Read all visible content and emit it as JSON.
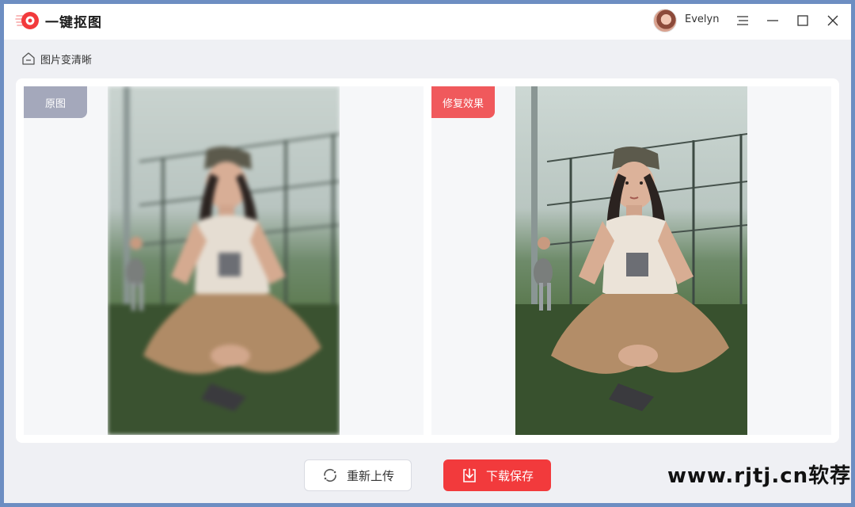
{
  "app": {
    "title": "一键抠图",
    "accent": "#f23a3c"
  },
  "user": {
    "name": "Evelyn"
  },
  "window_controls": [
    "menu-icon",
    "minimize-icon",
    "maximize-icon",
    "close-icon"
  ],
  "breadcrumb": {
    "icon": "home-icon",
    "label": "图片变清晰"
  },
  "panels": {
    "original_tag": "原图",
    "result_tag": "修复效果"
  },
  "actions": {
    "reupload_label": "重新上传",
    "download_label": "下载保存"
  },
  "watermark": "www.rjtj.cn软荐网"
}
